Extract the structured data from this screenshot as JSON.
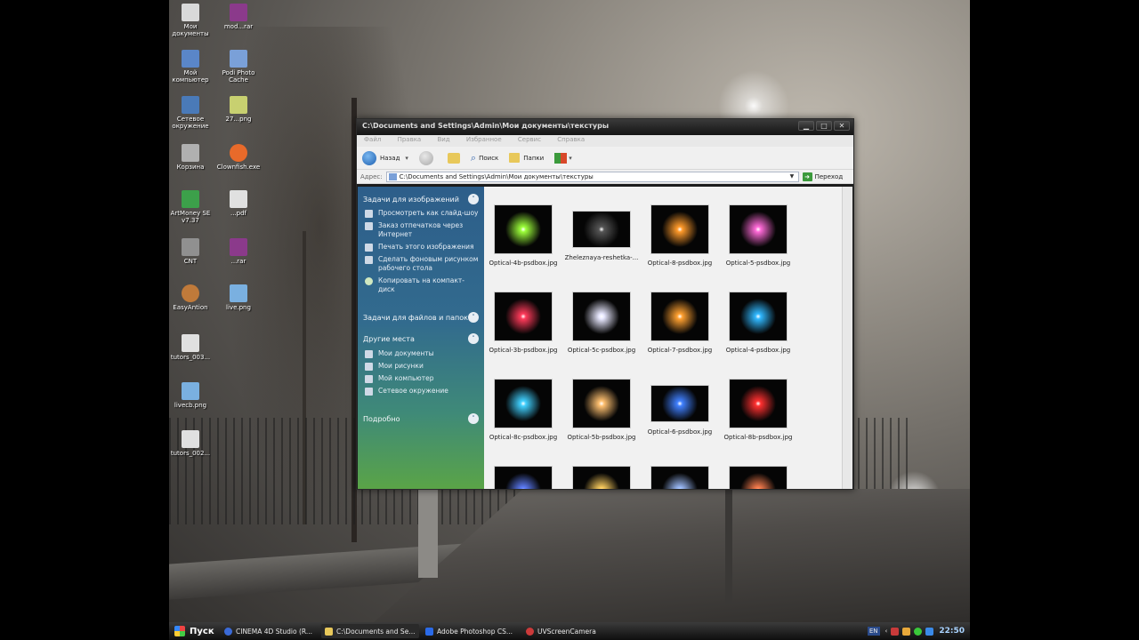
{
  "desktop": {
    "icons": [
      {
        "label": "Мои документы",
        "icon": "my-documents-icon",
        "color": "#d9d9d9"
      },
      {
        "label": "mod...rar",
        "icon": "rar-archive-icon",
        "color": "#8b3a8b"
      },
      {
        "label": "Мой компьютер",
        "icon": "my-computer-icon",
        "color": "#5a86c8"
      },
      {
        "label": "Podi Photo Cache",
        "icon": "folder-icon",
        "color": "#7aa0d8"
      },
      {
        "label": "Сетевое окружение",
        "icon": "network-icon",
        "color": "#4a7ab8"
      },
      {
        "label": "27...png",
        "icon": "image-file-icon",
        "color": "#c8d070"
      },
      {
        "label": "Корзина",
        "icon": "recycle-bin-icon",
        "color": "#b0b0b0"
      },
      {
        "label": "Clownfish.exe",
        "icon": "clownfish-icon",
        "color": "#e86a2a"
      },
      {
        "label": "ArtMoney SE v7.37",
        "icon": "artmoney-icon",
        "color": "#3ca04a"
      },
      {
        "label": "...pdf",
        "icon": "document-icon",
        "color": "#e0e0e0"
      },
      {
        "label": "CNT",
        "icon": "cnt-icon",
        "color": "#909090"
      },
      {
        "label": "...rar",
        "icon": "rar-archive-icon",
        "color": "#8b3a8b"
      },
      {
        "label": "EasyAntion",
        "icon": "bear-icon",
        "color": "#c07a3a"
      },
      {
        "label": "live.png",
        "icon": "image-file-icon",
        "color": "#7ab0e0"
      },
      {
        "label": "tutors_003...",
        "icon": "document-icon",
        "color": "#e0e0e0"
      },
      {
        "label": "livecb.png",
        "icon": "image-file-icon",
        "color": "#7ab0e0"
      },
      {
        "label": "tutors_002...",
        "icon": "document-icon",
        "color": "#e0e0e0"
      }
    ]
  },
  "window": {
    "title": "C:\\Documents and Settings\\Admin\\Мои документы\\текстуры",
    "buttons": {
      "minimize": "▁",
      "maximize": "□",
      "close": "✕"
    },
    "menu": [
      "Файл",
      "Правка",
      "Вид",
      "Избранное",
      "Сервис",
      "Справка"
    ],
    "toolbar": {
      "back": "Назад",
      "search": "Поиск",
      "folders": "Папки"
    },
    "address": {
      "label": "Адрес:",
      "value": "C:\\Documents and Settings\\Admin\\Мои документы\\текстуры",
      "go": "Переход"
    },
    "sidebar": {
      "image_tasks": {
        "title": "Задачи для изображений",
        "items": [
          "Просмотреть как слайд-шоу",
          "Заказ отпечатков через Интернет",
          "Печать этого изображения",
          "Сделать фоновым рисунком рабочего стола",
          "Копировать на компакт-диск"
        ]
      },
      "file_tasks": {
        "title": "Задачи для файлов и папок"
      },
      "other_places": {
        "title": "Другие места",
        "items": [
          "Мои документы",
          "Мои рисунки",
          "Мой компьютер",
          "Сетевое окружение"
        ]
      },
      "details": {
        "title": "Подробно"
      }
    },
    "files": [
      {
        "name": "Optical-4b-psdbox.jpg",
        "glow": "#9cff3a"
      },
      {
        "name": "Zheleznaya-reshetka-...",
        "glow": "#555555"
      },
      {
        "name": "Optical-8-psdbox.jpg",
        "glow": "#ff9a2a"
      },
      {
        "name": "Optical-5-psdbox.jpg",
        "glow": "#ff6ad8"
      },
      {
        "name": "Optical-3b-psdbox.jpg",
        "glow": "#ff3a5a"
      },
      {
        "name": "Optical-5c-psdbox.jpg",
        "glow": "#e8e8ff"
      },
      {
        "name": "Optical-7-psdbox.jpg",
        "glow": "#ffa030"
      },
      {
        "name": "Optical-4-psdbox.jpg",
        "glow": "#30b8ff"
      },
      {
        "name": "Optical-8c-psdbox.jpg",
        "glow": "#40d0ff"
      },
      {
        "name": "Optical-5b-psdbox.jpg",
        "glow": "#ffc070"
      },
      {
        "name": "Optical-6-psdbox.jpg",
        "glow": "#4080ff"
      },
      {
        "name": "Optical-8b-psdbox.jpg",
        "glow": "#ff3030"
      },
      {
        "name": "",
        "glow": "#6080ff"
      },
      {
        "name": "",
        "glow": "#ffd060"
      },
      {
        "name": "",
        "glow": "#a0c0ff"
      },
      {
        "name": "",
        "glow": "#ff8050"
      }
    ]
  },
  "taskbar": {
    "start": "Пуск",
    "buttons": [
      {
        "label": "CINEMA 4D Studio (R...",
        "icon": "cinema4d-icon",
        "color": "#3a6ad8"
      },
      {
        "label": "C:\\Documents and Se...",
        "icon": "folder-icon",
        "color": "#e8c85a"
      },
      {
        "label": "Adobe Photoshop CS...",
        "icon": "photoshop-icon",
        "color": "#2a6ae8"
      },
      {
        "label": "UVScreenCamera",
        "icon": "camera-icon",
        "color": "#cc3a3a"
      }
    ],
    "tray": {
      "lang": "EN",
      "clock": "22:50"
    }
  }
}
